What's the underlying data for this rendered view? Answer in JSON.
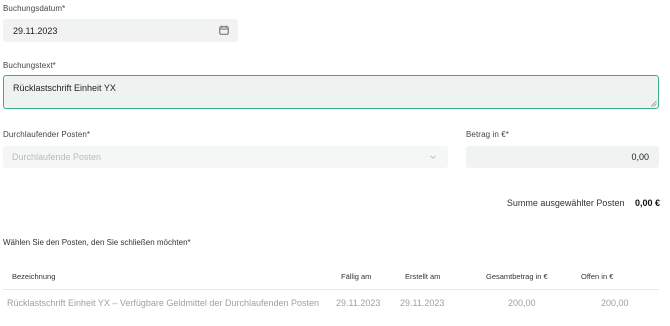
{
  "booking_date": {
    "label": "Buchungsdatum*",
    "value": "29.11.2023",
    "icon": "calendar-icon"
  },
  "booking_text": {
    "label": "Buchungstext*",
    "value": "Rücklastschrift Einheit YX"
  },
  "transit_item": {
    "label": "Durchlaufender Posten*",
    "placeholder": "Durchlaufende Posten",
    "icon": "chevron-down-icon"
  },
  "amount": {
    "label": "Betrag in €*",
    "value": "0,00"
  },
  "summary": {
    "label": "Summe ausgewählter Posten",
    "value": "0,00 €"
  },
  "table": {
    "intro": "Wählen Sie den Posten, den Sie schließen möchten*",
    "headers": [
      "Bezeichnung",
      "Fällig am",
      "Erstellt am",
      "Gesamtbetrag in €",
      "Offen in €"
    ],
    "rows": [
      [
        "Rücklastschrift Einheit YX – Verfügbare Geldmittel der Durchlaufenden Posten",
        "29.11.2023",
        "29.11.2023",
        "200,00",
        "200,00"
      ]
    ]
  },
  "colors": {
    "focus_border": "#3caf86",
    "field_bg": "#f1f3f3"
  }
}
